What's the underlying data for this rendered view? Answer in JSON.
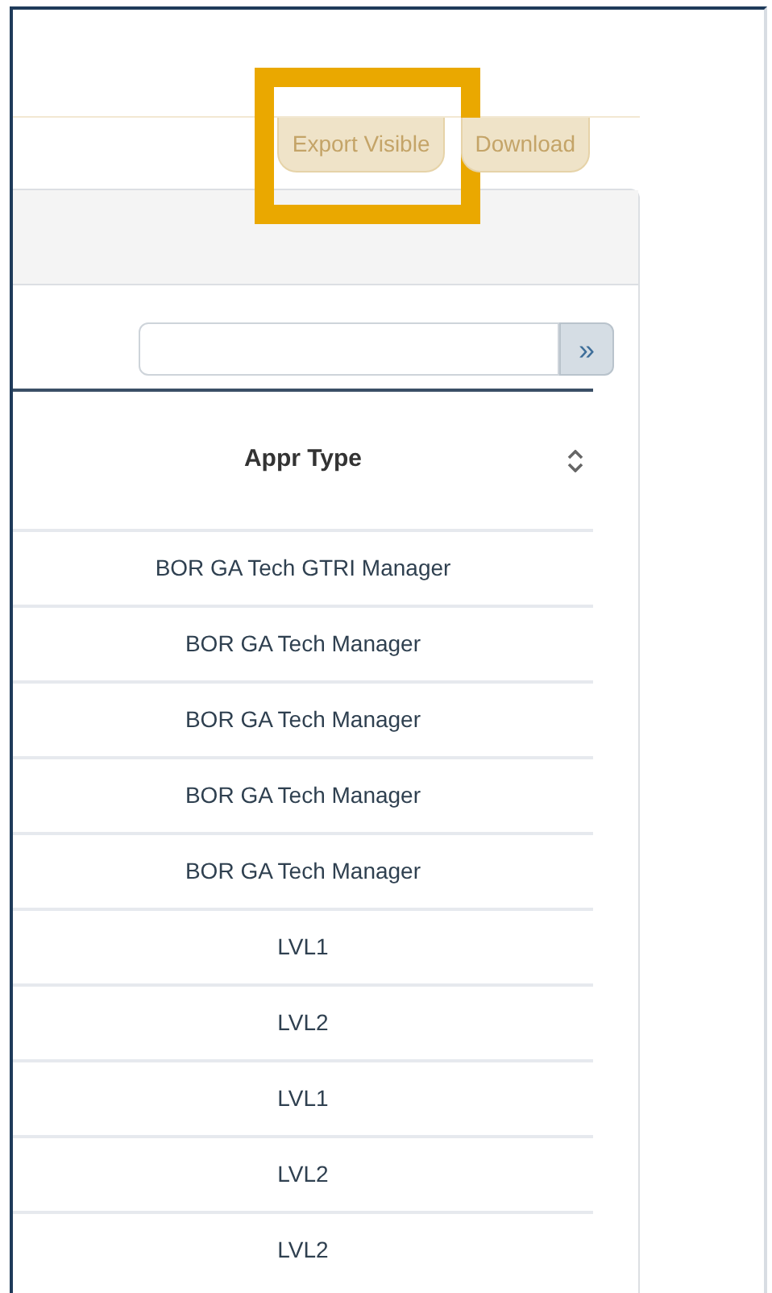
{
  "toolbar": {
    "buttons": [
      {
        "label": "Export Visible",
        "highlighted": true
      },
      {
        "label": "Download",
        "highlighted": false
      }
    ]
  },
  "search": {
    "button": "»"
  },
  "table": {
    "columns": [
      {
        "label": "Appr Type",
        "sortable": true
      }
    ],
    "rows": [
      [
        "BOR GA Tech GTRI Manager"
      ],
      [
        "BOR GA Tech Manager"
      ],
      [
        "BOR GA Tech Manager"
      ],
      [
        "BOR GA Tech Manager"
      ],
      [
        "BOR GA Tech Manager"
      ],
      [
        "LVL1"
      ],
      [
        "LVL2"
      ],
      [
        "LVL1"
      ],
      [
        "LVL2"
      ],
      [
        "LVL2"
      ]
    ]
  }
}
